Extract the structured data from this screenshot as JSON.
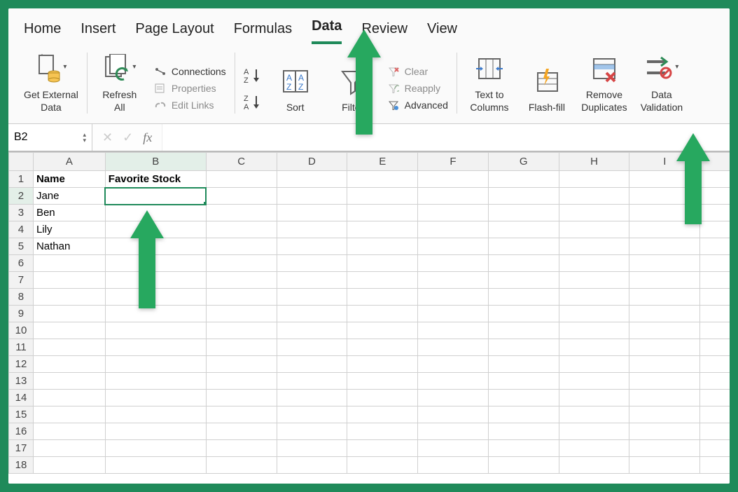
{
  "tabs": {
    "items": [
      "Home",
      "Insert",
      "Page Layout",
      "Formulas",
      "Data",
      "Review",
      "View"
    ],
    "active": "Data"
  },
  "ribbon": {
    "get_external_data": "Get External\nData",
    "refresh_all": "Refresh\nAll",
    "connections": "Connections",
    "properties": "Properties",
    "edit_links": "Edit Links",
    "sort_az": "A↓Z",
    "sort_za": "Z↓A",
    "sort": "Sort",
    "filter": "Filter",
    "clear": "Clear",
    "reapply": "Reapply",
    "advanced": "Advanced",
    "text_to_columns": "Text to\nColumns",
    "flash_fill": "Flash-fill",
    "remove_duplicates": "Remove\nDuplicates",
    "data_validation": "Data\nValidation"
  },
  "formula_bar": {
    "name_box": "B2",
    "fx_label": "fx",
    "value": ""
  },
  "grid": {
    "columns": [
      "A",
      "B",
      "C",
      "D",
      "E",
      "F",
      "G",
      "H",
      "I"
    ],
    "rows": [
      1,
      2,
      3,
      4,
      5,
      6,
      7,
      8,
      9,
      10,
      11,
      12,
      13,
      14,
      15,
      16,
      17,
      18
    ],
    "selected_cell": "B2",
    "data": {
      "A1": "Name",
      "B1": "Favorite Stock",
      "A2": "Jane",
      "A3": "Ben",
      "A4": "Lily",
      "A5": "Nathan"
    },
    "bold_cells": [
      "A1",
      "B1"
    ]
  },
  "colors": {
    "accent": "#1f8a5a"
  }
}
